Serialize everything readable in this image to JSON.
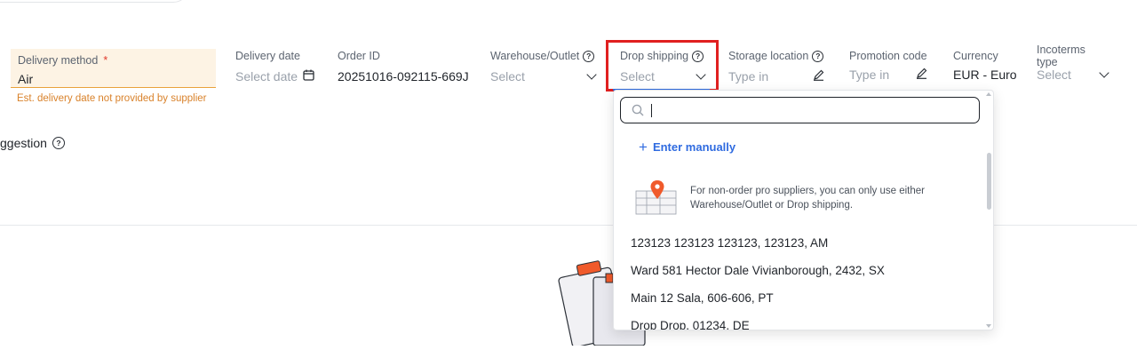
{
  "fields": {
    "delivery_method": {
      "label": "Delivery method",
      "required": "*",
      "value": "Air",
      "hint": "Est. delivery date not provided by supplier"
    },
    "delivery_date": {
      "label": "Delivery date",
      "placeholder": "Select date"
    },
    "order_id": {
      "label": "Order ID",
      "value": "20251016-092115-669J"
    },
    "warehouse": {
      "label": "Warehouse/Outlet",
      "placeholder": "Select"
    },
    "drop_shipping": {
      "label": "Drop shipping",
      "placeholder": "Select"
    },
    "storage_location": {
      "label": "Storage location",
      "placeholder": "Type in"
    },
    "promotion_code": {
      "label": "Promotion code",
      "placeholder": "Type in"
    },
    "currency": {
      "label": "Currency",
      "value": "EUR - Euro"
    },
    "incoterms": {
      "label": "Incoterms type",
      "placeholder": "Select"
    }
  },
  "suggestion_label": "ggestion",
  "dropdown": {
    "search_value": "",
    "enter_manually": "Enter manually",
    "info": "For non-order pro suppliers, you can only use either Warehouse/Outlet or Drop shipping.",
    "addresses": [
      "123123 123123 123123, 123123, AM",
      "Ward 581 Hector Dale Vivianborough, 2432, SX",
      "Main 12 Sala, 606-606, PT",
      "Drop Drop, 01234, DE"
    ]
  },
  "colors": {
    "accent": "#2f6be0",
    "highlight": "#e02020",
    "warning": "#d9822b",
    "warning_bg": "#fdf3e4"
  }
}
